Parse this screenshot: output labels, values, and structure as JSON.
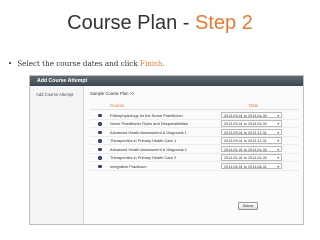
{
  "slide": {
    "title_prefix": "Course Plan - ",
    "title_step": "Step 2",
    "bullet_symbol": "•",
    "instruction_text": "Select the course dates and click ",
    "instruction_action": "Finish."
  },
  "app": {
    "header_title": "Add Course Attempt",
    "side_label": "Add Course Attempt",
    "plan_title": "Sample Course Plan >>",
    "columns": {
      "course": "Course",
      "date": "Date"
    },
    "dropdown_icon": "dropdown-arrow-icon",
    "courses": [
      {
        "name": "Pathophysiology for the Nurse Practitioner",
        "date": "2013-09-01  to  2014-04-30"
      },
      {
        "name": "Nurse Practitioner Roles and Responsibilities",
        "date": "2013-09-01  to  2014-04-30"
      },
      {
        "name": "Advanced Health Assessment & Diagnosis 1",
        "date": "2013-09-01  to  2013-12-31"
      },
      {
        "name": "Therapeutics in Primary Health Care 1",
        "date": "2013-09-01  to  2013-12-31"
      },
      {
        "name": "Advanced Health Assessment & Diagnosis 2",
        "date": "2014-01-01  to  2014-04-30"
      },
      {
        "name": "Therapeutics in Primary Health Care 2",
        "date": "2014-01-01  to  2014-04-30"
      },
      {
        "name": "Integrative Practicum",
        "date": "2014-05-01  to  2014-08-31"
      }
    ],
    "select_button_label": "Select"
  },
  "colors": {
    "accent": "#e8792f",
    "header_bg": "#4a545b",
    "radio": "#3a4a9a"
  }
}
